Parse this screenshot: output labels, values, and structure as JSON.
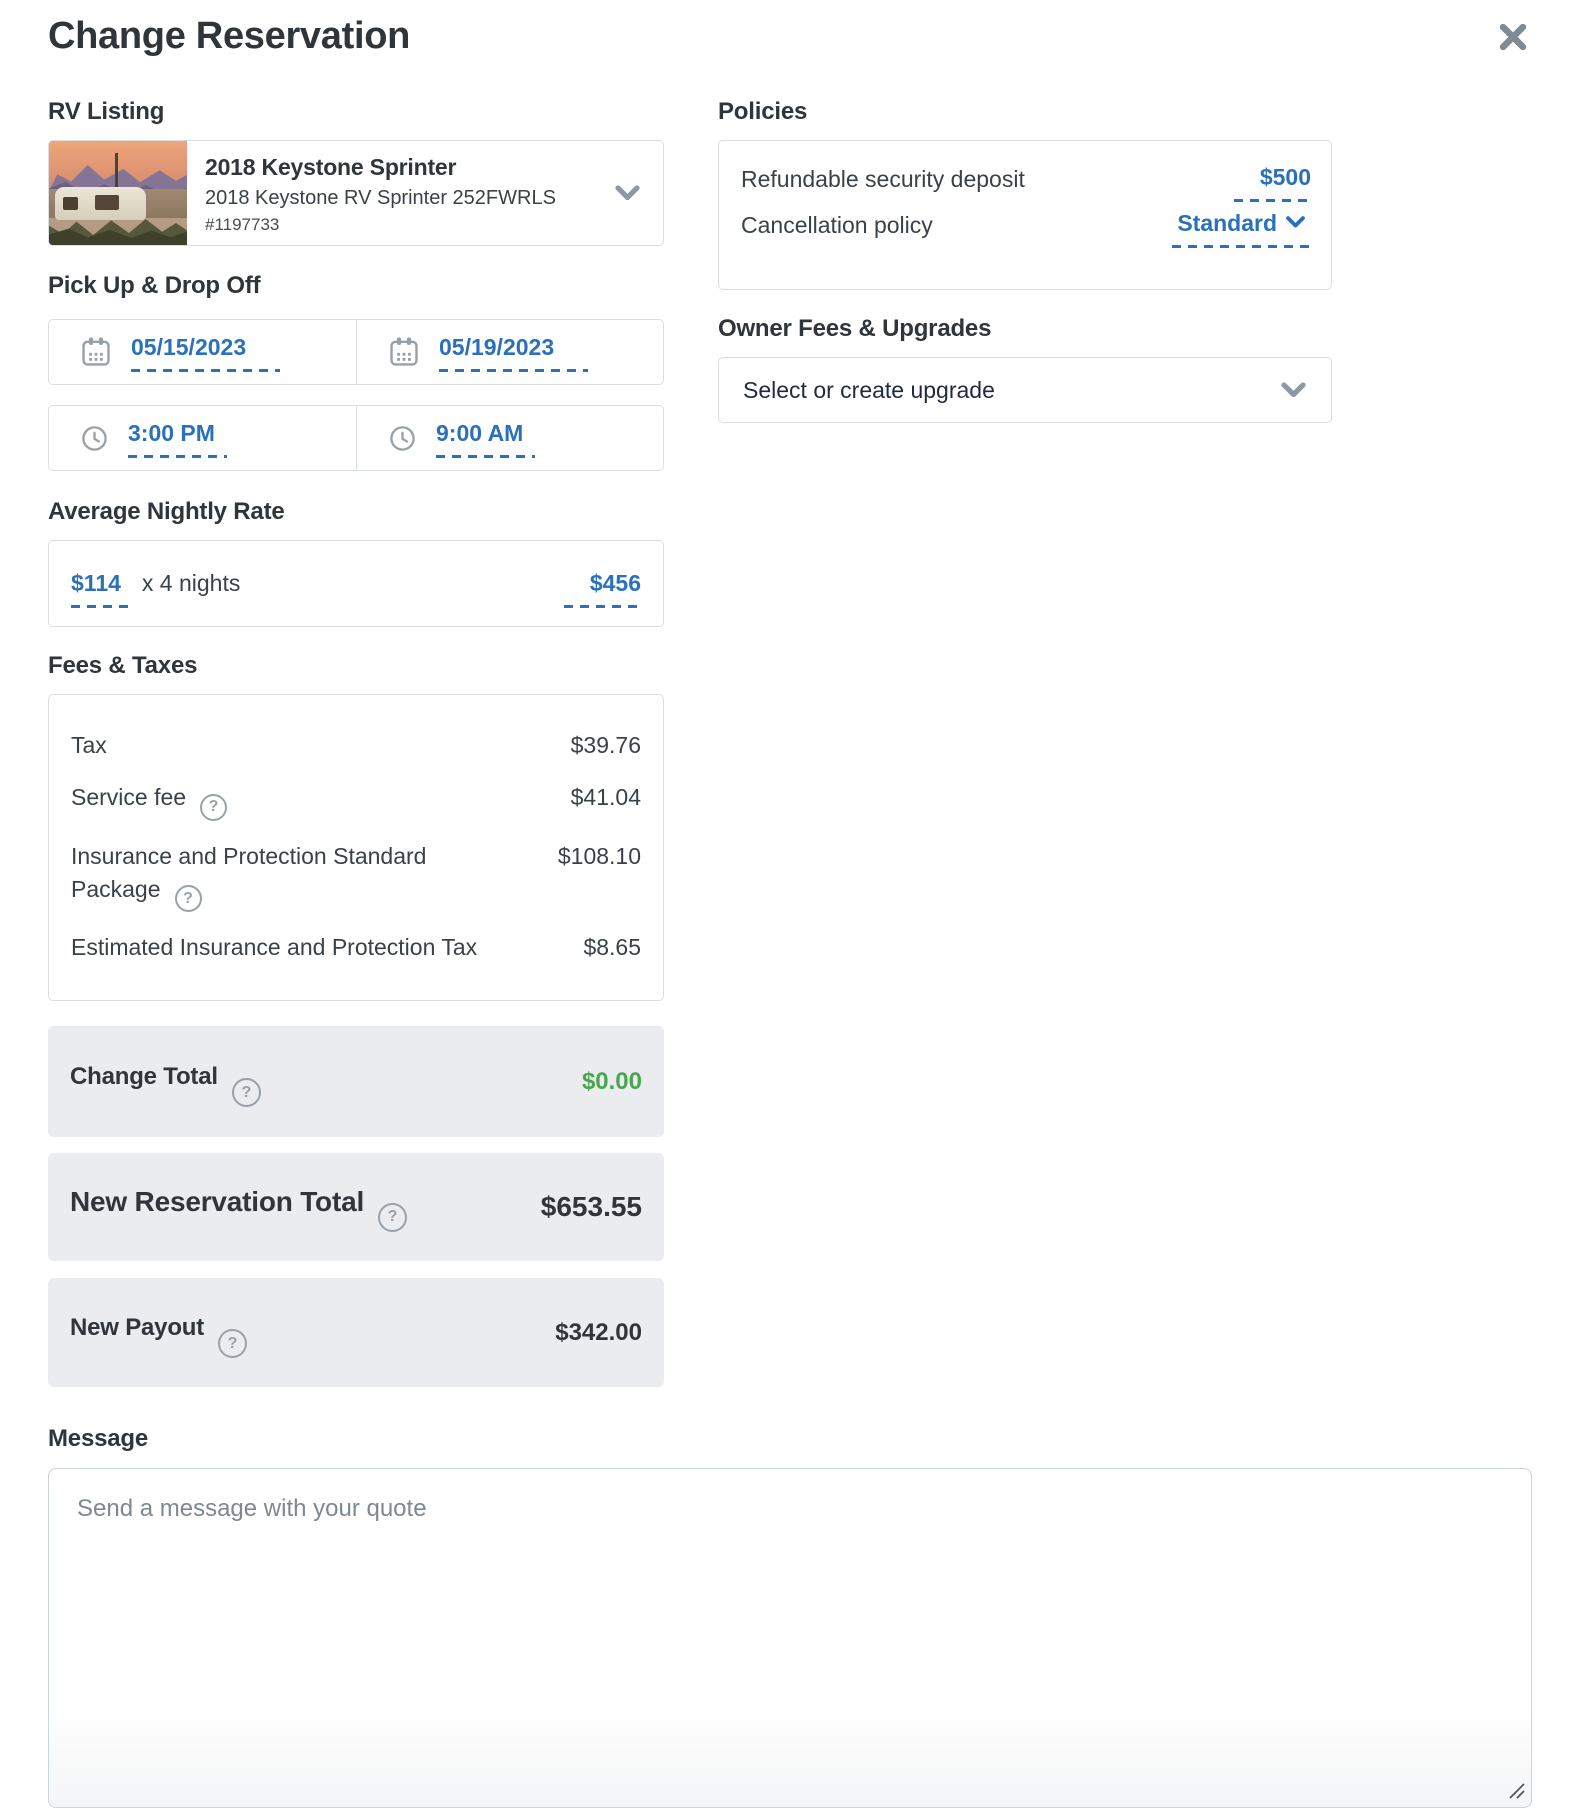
{
  "modal": {
    "title": "Change Reservation"
  },
  "icons": {
    "help": "?"
  },
  "rv_listing": {
    "section_title": "RV Listing",
    "name": "2018 Keystone Sprinter",
    "description": "2018 Keystone RV Sprinter 252FWRLS",
    "listing_id": "#1197733"
  },
  "pickup_dropoff": {
    "section_title": "Pick Up & Drop Off",
    "pickup_date": "05/15/2023",
    "dropoff_date": "05/19/2023",
    "pickup_time": "3:00 PM",
    "dropoff_time": "9:00 AM"
  },
  "nightly_rate": {
    "section_title": "Average Nightly Rate",
    "rate": "$114",
    "multiplier": "x 4 nights",
    "total": "$456"
  },
  "fees_taxes": {
    "section_title": "Fees & Taxes",
    "rows": [
      {
        "label": "Tax",
        "value": "$39.76"
      },
      {
        "label": "Service fee",
        "value": "$41.04"
      },
      {
        "label": "Insurance and Protection Standard Package",
        "value": "$108.10"
      },
      {
        "label": "Estimated Insurance and Protection Tax",
        "value": "$8.65"
      }
    ]
  },
  "totals": {
    "change_total": {
      "label": "Change Total",
      "value": "$0.00"
    },
    "new_reservation_total": {
      "label": "New Reservation Total",
      "value": "$653.55"
    },
    "new_payout": {
      "label": "New Payout",
      "value": "$342.00"
    }
  },
  "policies": {
    "section_title": "Policies",
    "security_deposit_label": "Refundable security deposit",
    "security_deposit_value": "$500",
    "cancellation_label": "Cancellation policy",
    "cancellation_value": "Standard"
  },
  "owner_fees": {
    "section_title": "Owner Fees & Upgrades",
    "select_placeholder": "Select or create upgrade"
  },
  "message": {
    "section_title": "Message",
    "placeholder": "Send a message with your quote"
  },
  "colors": {
    "accent_blue": "#2a70ba",
    "success_green": "#4aa64e",
    "text_dark": "#2f353b",
    "icon_gray": "#98a1aa",
    "box_gray": "#eaecf0"
  }
}
